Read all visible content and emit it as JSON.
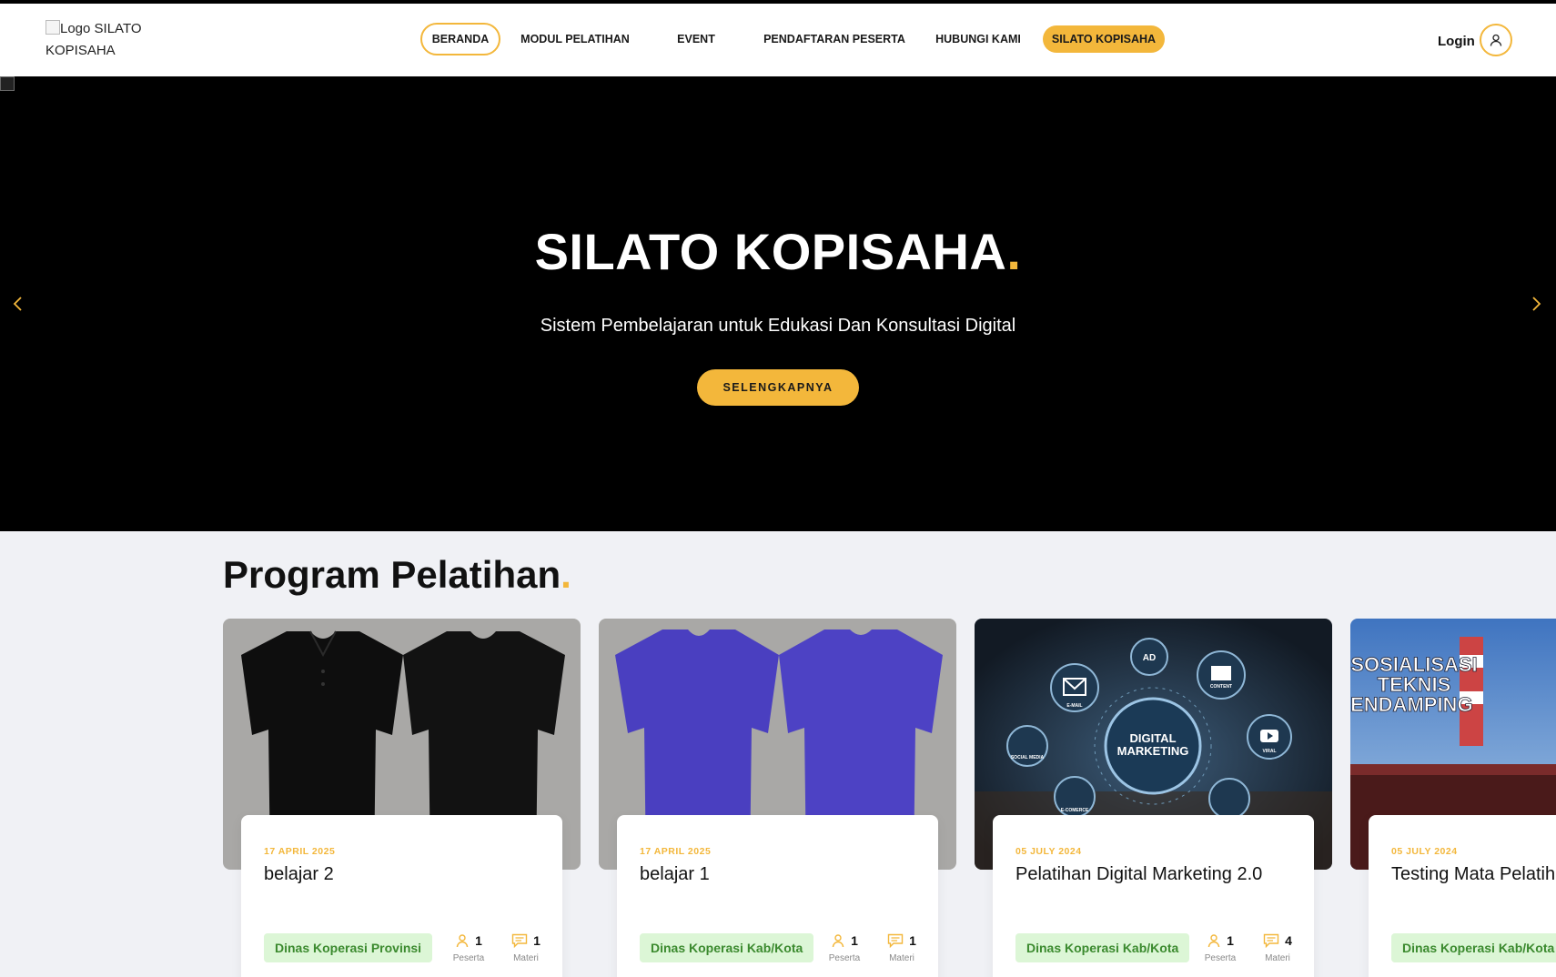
{
  "header": {
    "logo_alt": "Logo SILATO KOPISAHA",
    "nav": [
      {
        "label": "BERANDA"
      },
      {
        "label": "MODUL PELATIHAN"
      },
      {
        "label": "EVENT"
      },
      {
        "label": "PENDAFTARAN PESERTA"
      },
      {
        "label": "HUBUNGI KAMI"
      },
      {
        "label": "SILATO KOPISAHA"
      }
    ],
    "login_label": "Login"
  },
  "hero": {
    "title": "SILATO KOPISAHA",
    "title_dot": ".",
    "subtitle": "Sistem Pembelajaran untuk Edukasi Dan Konsultasi Digital",
    "cta_label": "SELENGKAPNYA"
  },
  "section": {
    "title": "Program Pelatihan",
    "title_dot": "."
  },
  "cards": [
    {
      "date": "17 APRIL 2025",
      "title": "belajar 2",
      "tag": "Dinas Koperasi Provinsi",
      "peserta_count": "1",
      "peserta_label": "Peserta",
      "materi_count": "1",
      "materi_label": "Materi"
    },
    {
      "date": "17 APRIL 2025",
      "title": "belajar 1",
      "tag": "Dinas Koperasi Kab/Kota",
      "peserta_count": "1",
      "peserta_label": "Peserta",
      "materi_count": "1",
      "materi_label": "Materi"
    },
    {
      "date": "05 JULY 2024",
      "title": "Pelatihan Digital Marketing 2.0",
      "tag": "Dinas Koperasi Kab/Kota",
      "peserta_count": "1",
      "peserta_label": "Peserta",
      "materi_count": "4",
      "materi_label": "Materi",
      "image_text": [
        "DIGITAL",
        "MARKETING",
        "AD",
        "E-MAIL",
        "CONTENT",
        "SOCIAL MEDIA",
        "VIRAL",
        "E-COMERCE"
      ]
    },
    {
      "date": "05 JULY 2024",
      "title": "Testing Mata Pelatihan",
      "tag": "Dinas Koperasi Kab/Kota",
      "image_text": [
        "SOSIALISASI",
        "TEKNIS",
        "PENDAMPING"
      ]
    }
  ],
  "colors": {
    "accent": "#f3b73b",
    "tag_bg": "#dcf6d6",
    "tag_text": "#3b8a2e"
  }
}
